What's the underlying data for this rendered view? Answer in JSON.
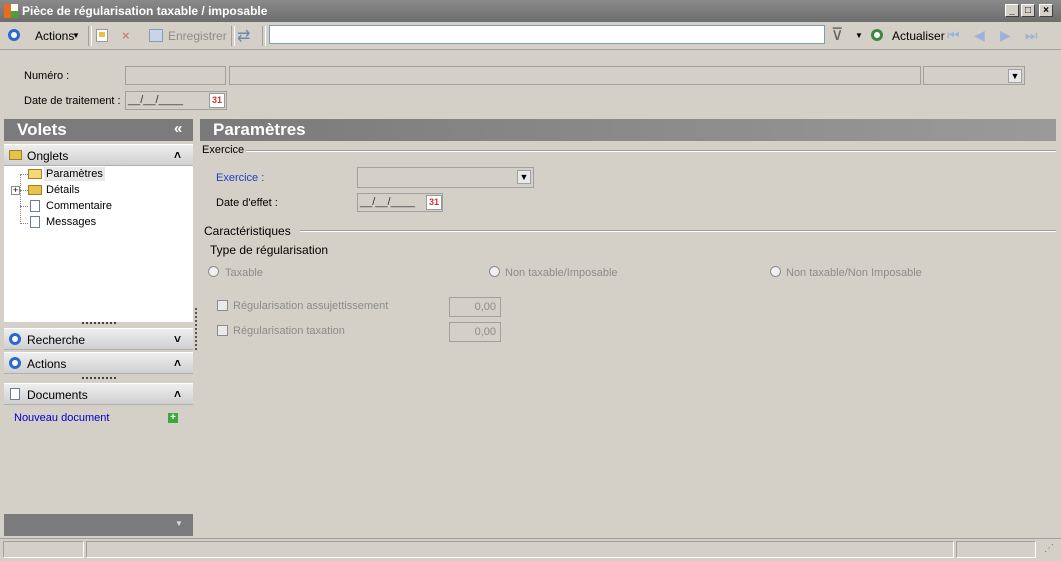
{
  "window": {
    "title": "Pièce de régularisation taxable / imposable",
    "buttons": {
      "minimize": "_",
      "maximize": "□",
      "close": "×"
    }
  },
  "toolbar": {
    "actions_label": "Actions",
    "save_label": "Enregistrer",
    "refresh_label": "Actualiser",
    "search_value": ""
  },
  "header": {
    "numero_label": "Numéro :",
    "date_label": "Date de traitement :",
    "date_value": "__/__/____",
    "cal_label": "31"
  },
  "left_panel": {
    "title": "Volets",
    "collapse": "«",
    "onglets_label": "Onglets",
    "tree": [
      {
        "label": "Paramètres"
      },
      {
        "label": "Détails"
      },
      {
        "label": "Commentaire"
      },
      {
        "label": "Messages"
      }
    ],
    "recherche_label": "Recherche",
    "actions_label": "Actions",
    "documents_label": "Documents",
    "new_document_label": "Nouveau document"
  },
  "main": {
    "title": "Paramètres",
    "exercice_group": "Exercice",
    "exercice_label": "Exercice :",
    "date_effet_label": "Date d'effet :",
    "date_effet_value": "__/__/____",
    "cal_label": "31",
    "caracteristiques_group": "Caractéristiques",
    "type_label": "Type de régularisation",
    "radios": [
      {
        "label": "Taxable"
      },
      {
        "label": "Non taxable/Imposable"
      },
      {
        "label": "Non taxable/Non Imposable"
      }
    ],
    "checks": [
      {
        "label": "Régularisation assujettissement",
        "value": "0,00"
      },
      {
        "label": "Régularisation taxation",
        "value": "0,00"
      }
    ]
  },
  "colors": {
    "accent_blue": "#1f5fbf",
    "link_blue": "#0000cc",
    "panel_gray": "#7b7b7b"
  }
}
